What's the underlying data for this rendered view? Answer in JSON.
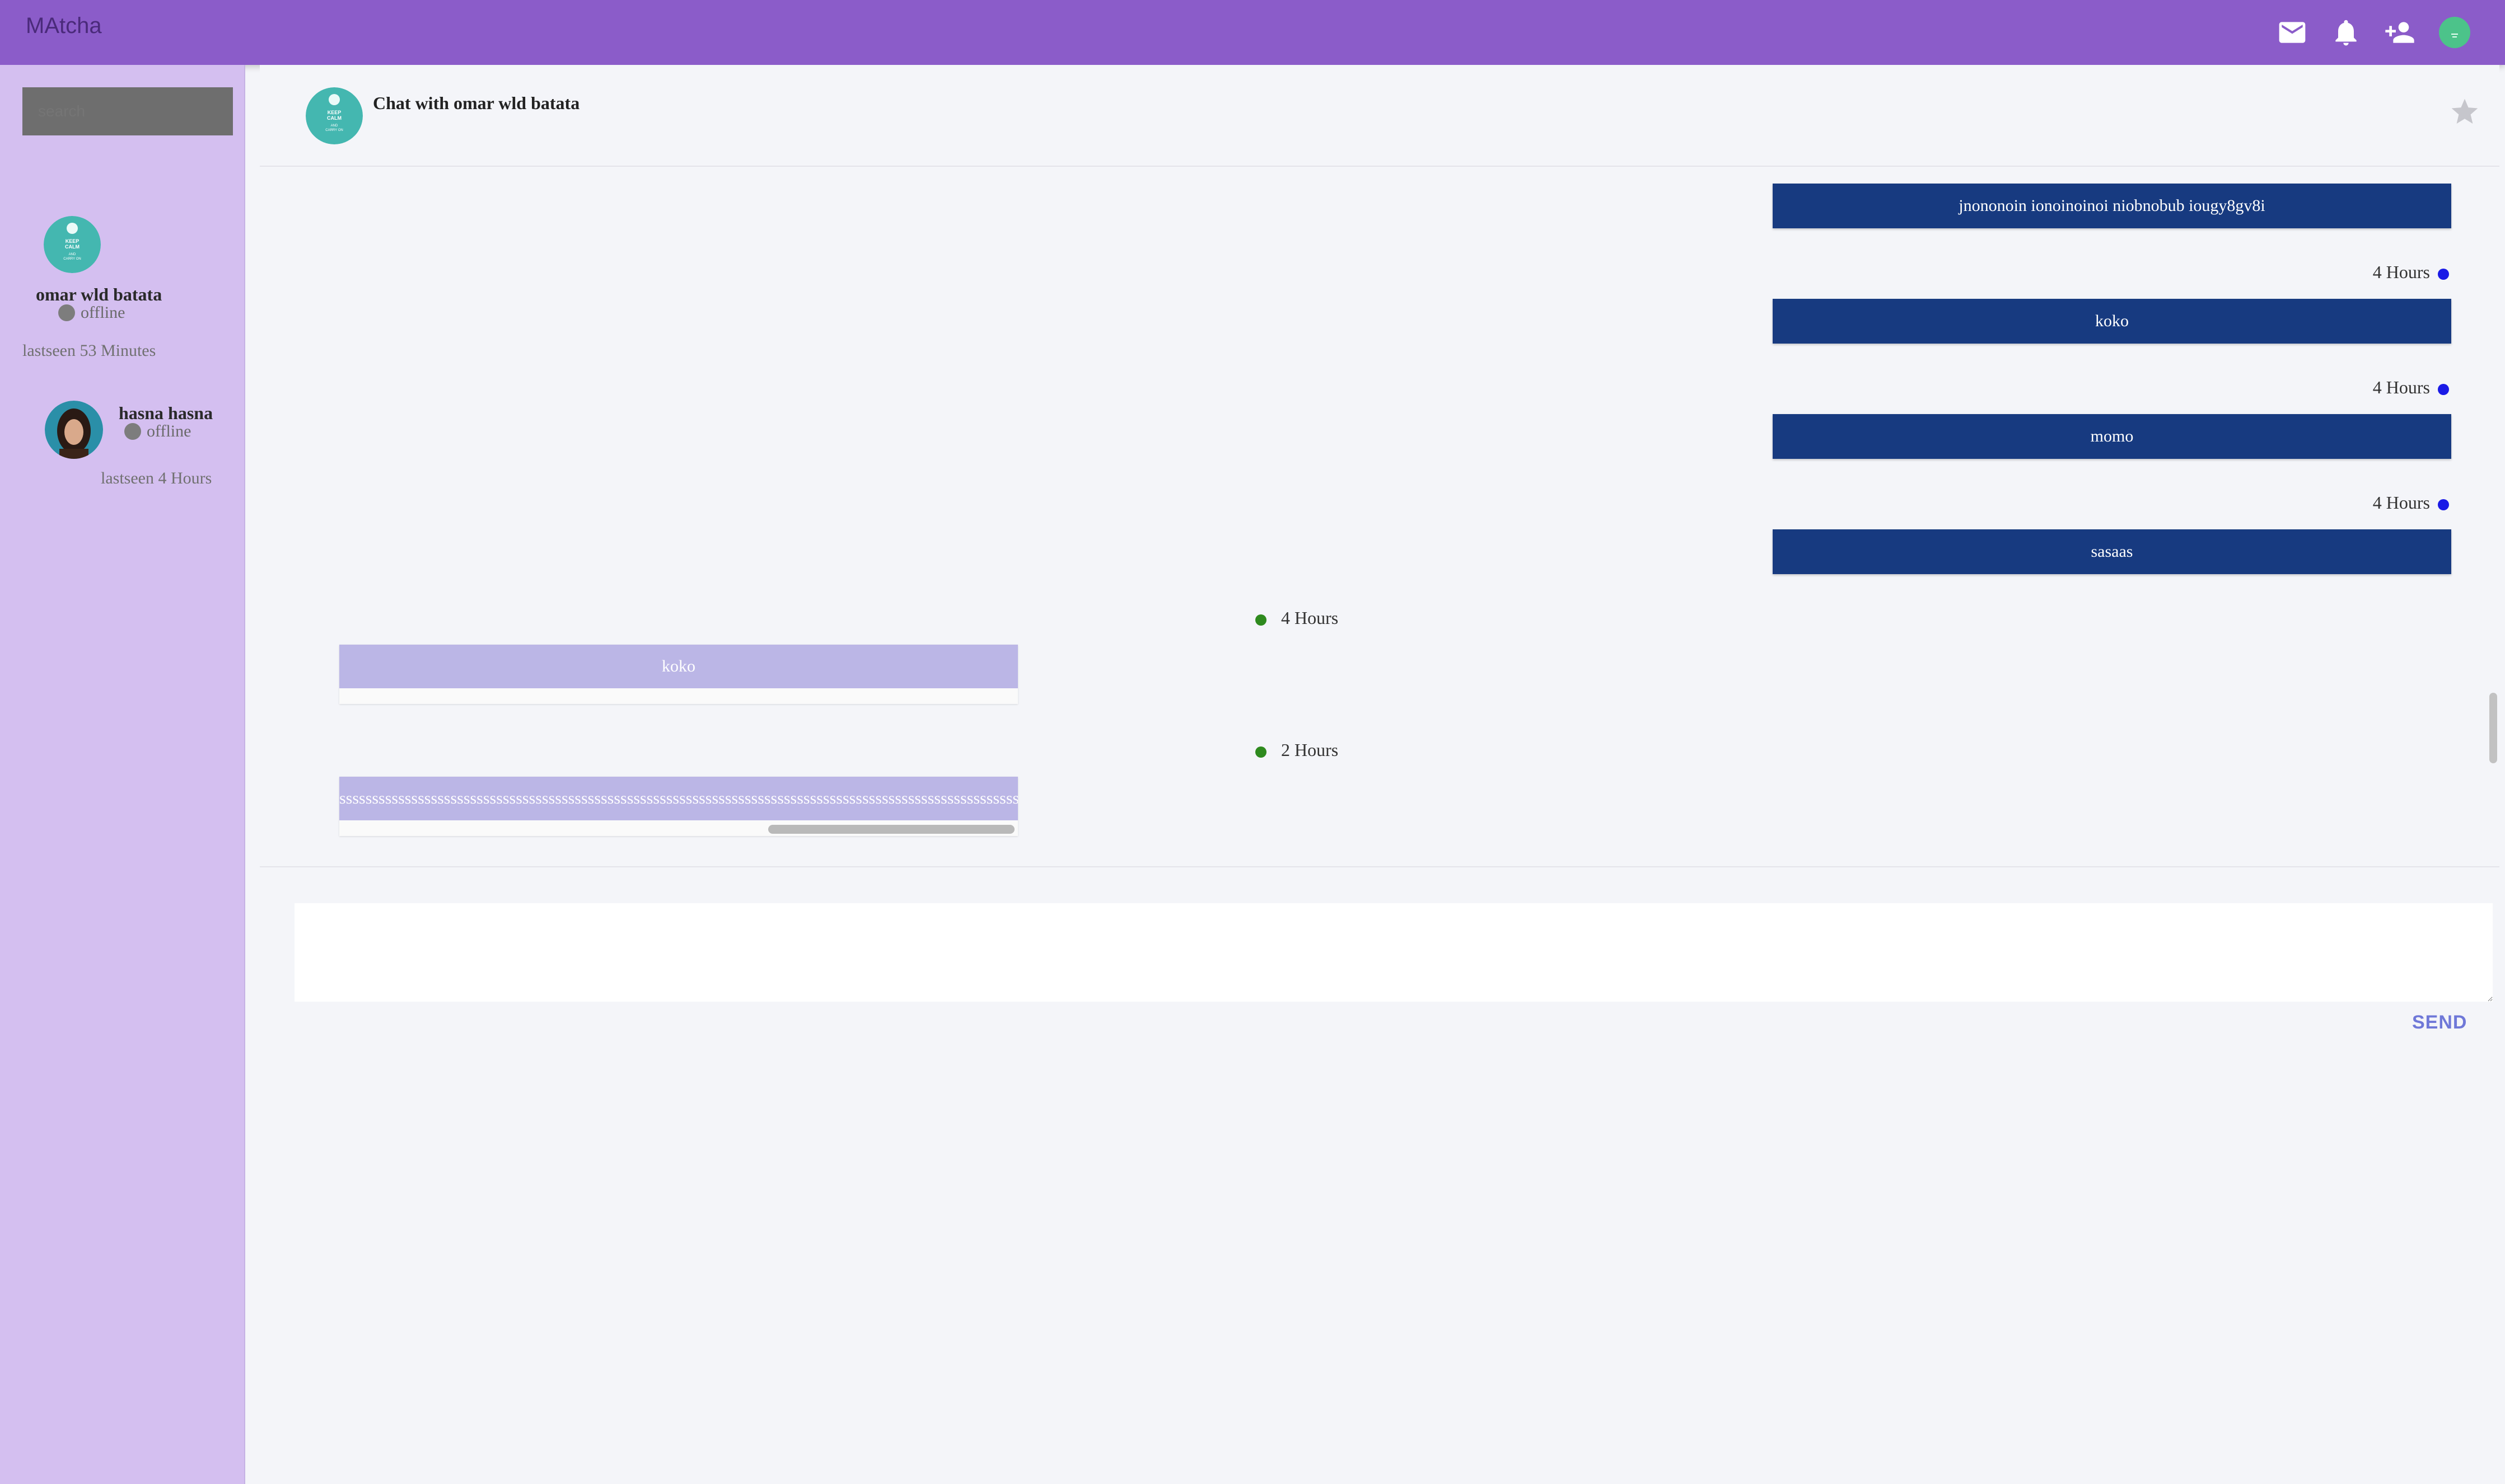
{
  "app": {
    "brand": "MAtcha"
  },
  "topbar": {
    "icons": [
      "mail-icon",
      "bell-icon",
      "add-friend-icon",
      "user-avatar"
    ],
    "bg_color": "#8b5cc9"
  },
  "sidebar": {
    "search_placeholder": "search",
    "contacts": [
      {
        "name": "omar wld batata",
        "status": "offline",
        "last_seen": "lastseen 53 Minutes",
        "avatar_text": [
          "KEEP",
          "CALM",
          "AND",
          "CARRY ON"
        ]
      },
      {
        "name": "hasna hasna",
        "status": "offline",
        "last_seen": "lastseen 4 Hours"
      }
    ]
  },
  "chat": {
    "title": "Chat with omar wld batata",
    "messages": [
      {
        "side": "sent",
        "text": "jnononoin ionoinoinoi niobnobub iougy8gv8i"
      },
      {
        "side": "sent",
        "time": "4 Hours",
        "text": "koko"
      },
      {
        "side": "sent",
        "time": "4 Hours",
        "text": "momo"
      },
      {
        "side": "sent",
        "time": "4 Hours",
        "text": "sasaas"
      },
      {
        "side": "received",
        "time": "4 Hours",
        "text": "koko"
      },
      {
        "side": "received",
        "time": "2 Hours",
        "text": "ssssssssssssssssssssssssssssssssssssssssssssssssssssssssssssssssssssssssssssssssssssssssssssssssssssssssssssssssssssssssssssssssssssssssssssssssssssssssssssssss"
      }
    ],
    "composer_value": "",
    "send_label": "SEND"
  },
  "colors": {
    "sent_bubble": "#173a80",
    "received_bubble": "#bbb6e6",
    "sidebar_bg": "#d4bff0",
    "online_dot_sent": "#1a1ae6",
    "online_dot_received": "#2e8a1e"
  }
}
